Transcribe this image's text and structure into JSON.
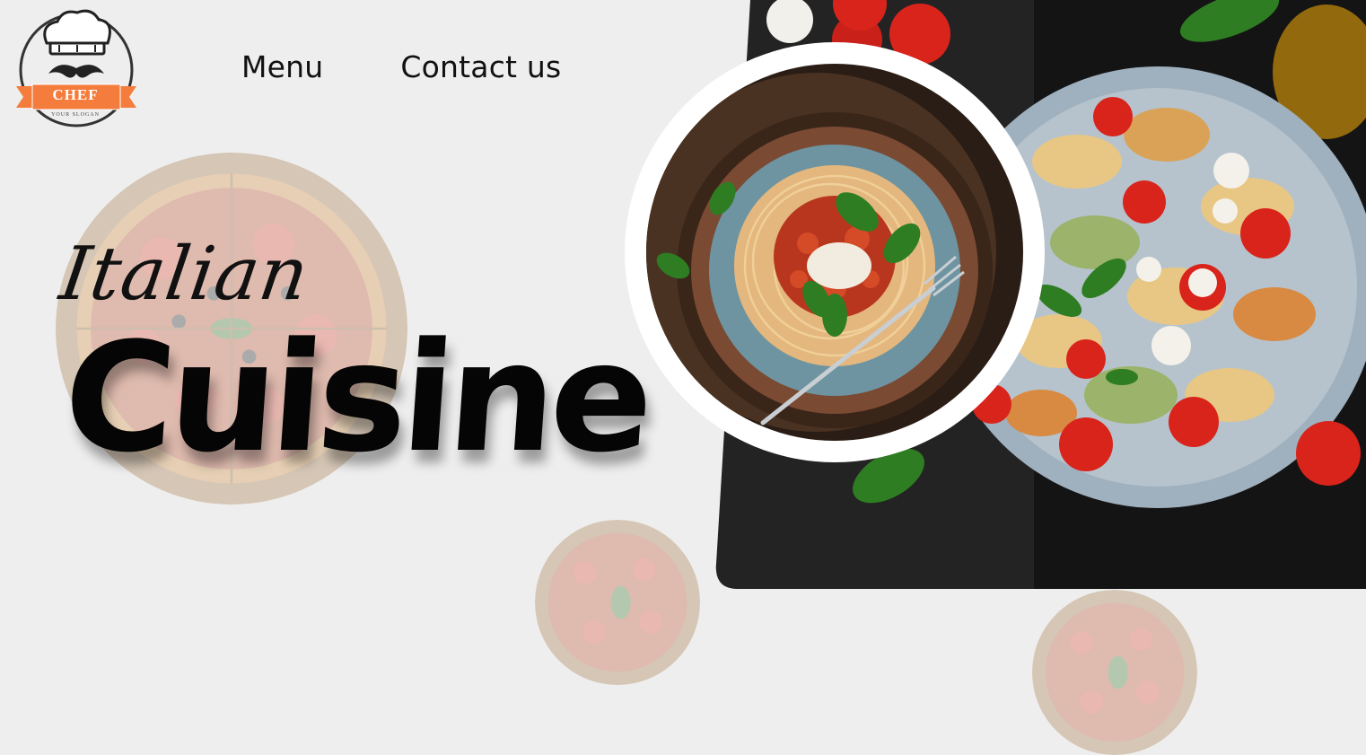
{
  "logo": {
    "title": "CHEF",
    "slogan": "YOUR SLOGAN"
  },
  "nav": {
    "items": [
      {
        "label": "Menu"
      },
      {
        "label": "Contact us"
      }
    ]
  },
  "hero": {
    "line1": "Italian",
    "line2": "Cuisine"
  },
  "colors": {
    "background": "#eeeeee",
    "logo_ribbon": "#f47c3c",
    "panel": "#1a1a1a",
    "text": "#111111"
  },
  "icons": [
    "chef-logo-icon",
    "spaghetti-plate-image",
    "farfalle-salad-image",
    "pizza-image"
  ]
}
